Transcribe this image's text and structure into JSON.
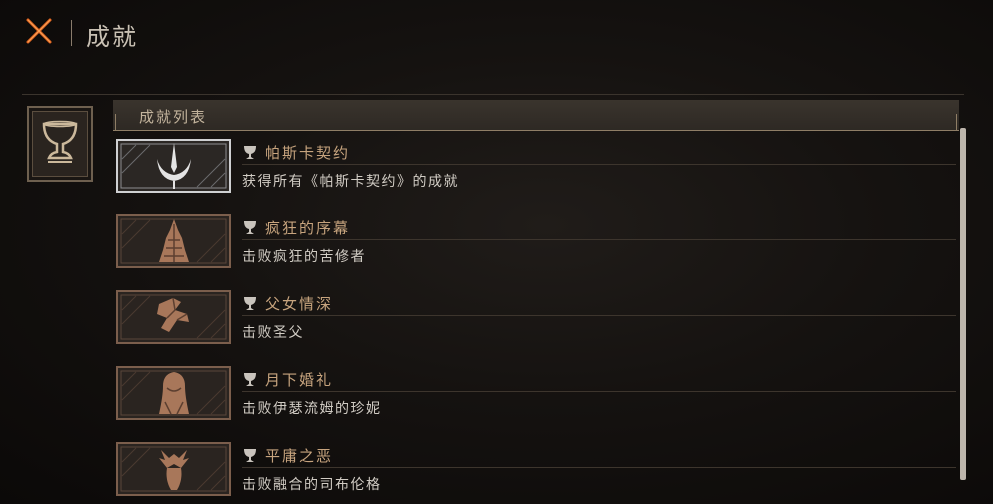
{
  "header": {
    "title": "成就",
    "close_icon": "close-x-icon"
  },
  "sidebar": {
    "tab_icon": "chalice-icon"
  },
  "list": {
    "header_label": "成就列表",
    "items": [
      {
        "title": "帕斯卡契约",
        "description": "获得所有《帕斯卡契约》的成就",
        "icon": "dark-crescent-blade-icon",
        "unlocked": true
      },
      {
        "title": "疯狂的序幕",
        "description": "击败疯狂的苦修者",
        "icon": "spiked-tower-icon",
        "unlocked": false
      },
      {
        "title": "父女情深",
        "description": "击败圣父",
        "icon": "broken-hands-icon",
        "unlocked": false
      },
      {
        "title": "月下婚礼",
        "description": "击败伊瑟流姆的珍妮",
        "icon": "veiled-bride-icon",
        "unlocked": false
      },
      {
        "title": "平庸之恶",
        "description": "击败融合的司布伦格",
        "icon": "antlered-beast-icon",
        "unlocked": false
      }
    ]
  },
  "colors": {
    "accent": "#c7a47e",
    "text": "#d1ccc4",
    "frame": "#8f7e66",
    "background": "#151210"
  }
}
